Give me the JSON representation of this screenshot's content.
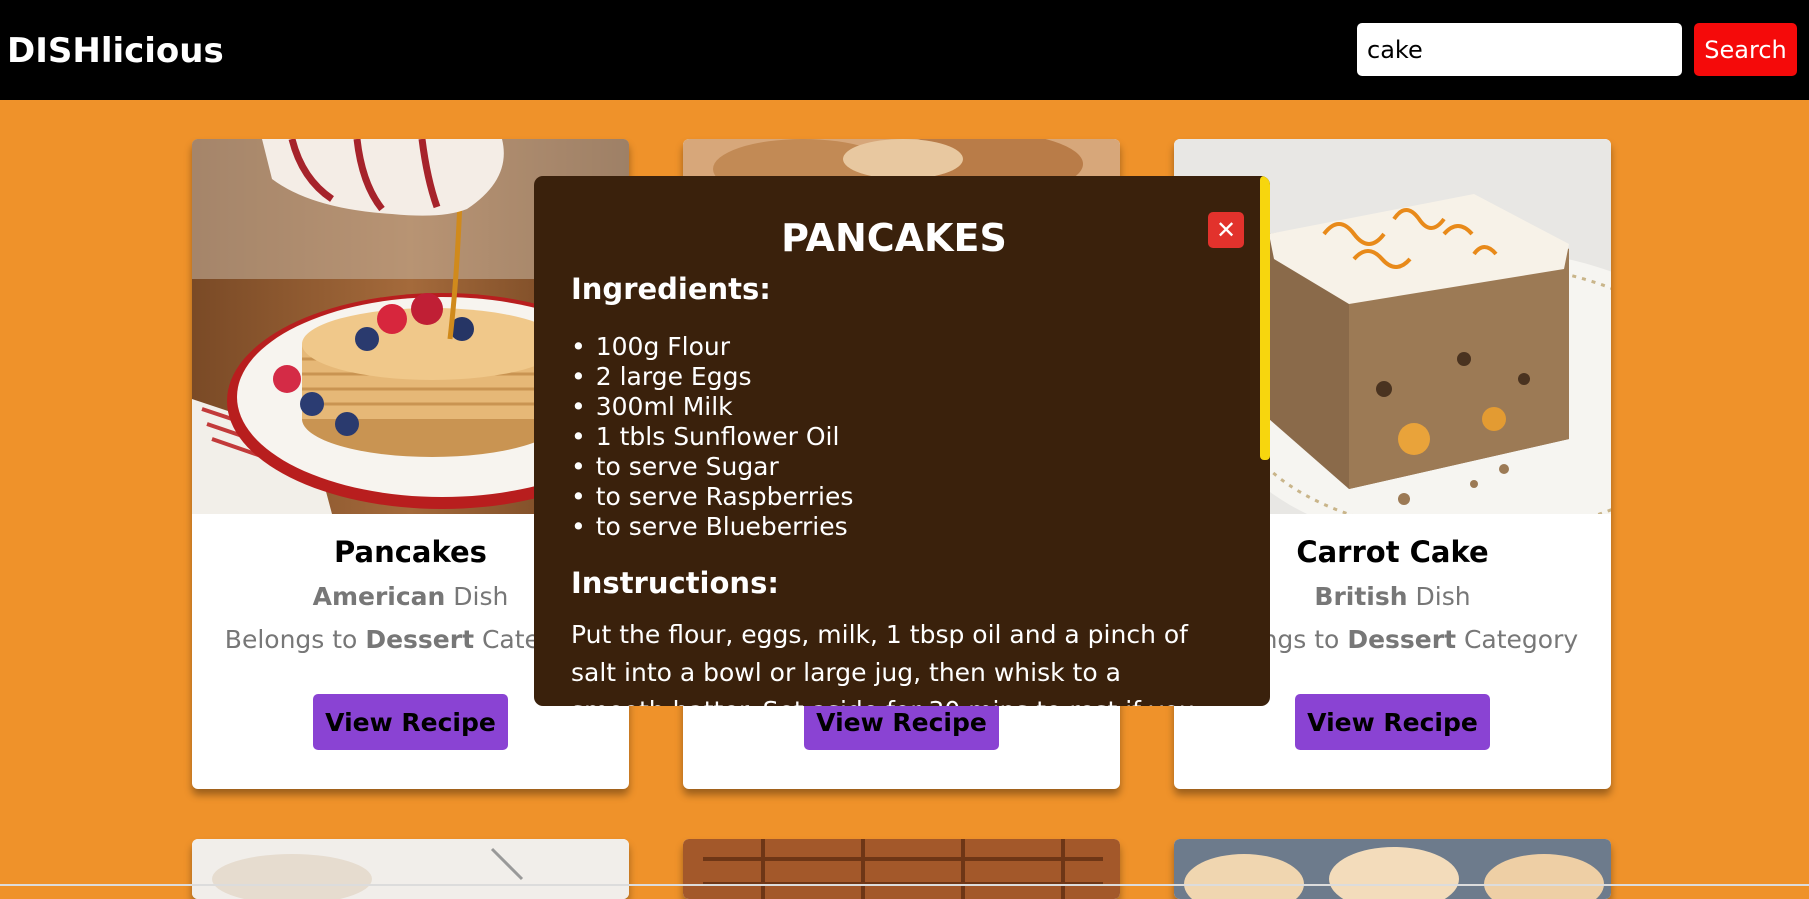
{
  "header": {
    "brand": "DISHlicious",
    "search_value": "cake",
    "search_button": "Search"
  },
  "cards": [
    {
      "title": "Pancakes",
      "cuisine": "American",
      "cuisine_suffix": " Dish",
      "category_prefix": "Belongs to ",
      "category": "Dessert",
      "category_suffix": " Category",
      "button": "View Recipe"
    },
    {
      "title": "",
      "cuisine": "",
      "cuisine_suffix": "",
      "category_prefix": "",
      "category": "",
      "category_suffix": "",
      "button": "View Recipe"
    },
    {
      "title": "Carrot Cake",
      "cuisine": "British",
      "cuisine_suffix": " Dish",
      "category_prefix": "Belongs to ",
      "category": "Dessert",
      "category_suffix": " Category",
      "button": "View Recipe"
    }
  ],
  "modal": {
    "title": "PANCAKES",
    "close_glyph": "✕",
    "ingredients_heading": "Ingredients:",
    "ingredients": [
      "100g Flour",
      "2 large Eggs",
      "300ml Milk",
      "1 tbls Sunflower Oil",
      "to serve Sugar",
      "to serve Raspberries",
      "to serve Blueberries"
    ],
    "instructions_heading": "Instructions:",
    "instructions": "Put the flour, eggs, milk, 1 tbsp oil and a pinch of salt into a bowl or large jug, then whisk to a smooth batter. Set aside for 30 mins to rest if you"
  },
  "colors": {
    "page_bg": "#ef922a",
    "header_bg": "#000000",
    "search_button": "#f50a0a",
    "view_button": "#8a43d3",
    "modal_bg": "#3a210c",
    "close_button": "#e2322c",
    "scrollbar": "#f7d60e"
  }
}
